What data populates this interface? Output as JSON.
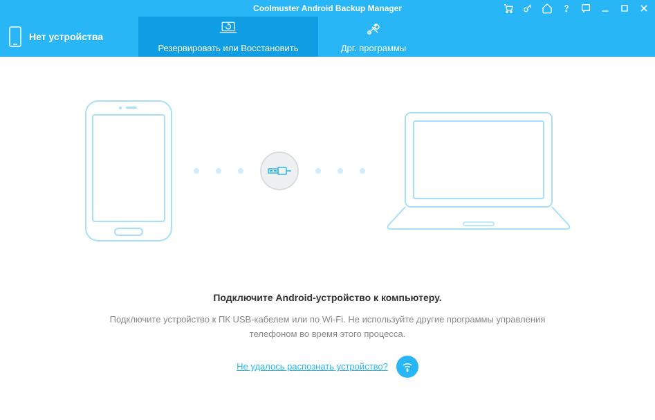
{
  "titlebar": {
    "title": "Coolmuster Android Backup Manager"
  },
  "device_status": {
    "label": "Нет устройства"
  },
  "tabs": {
    "backup_restore": "Резервировать или Восстановить",
    "other_programs": "Дрг. программы"
  },
  "content": {
    "heading": "Подключите Android-устройство к компьютеру.",
    "sub1": "Подключите устройство к ПК USB-кабелем или по Wi-Fi. Не используйте другие программы управления",
    "sub2": "телефоном во время этого процесса.",
    "help_link": "Не удалось распознать устройство?"
  }
}
